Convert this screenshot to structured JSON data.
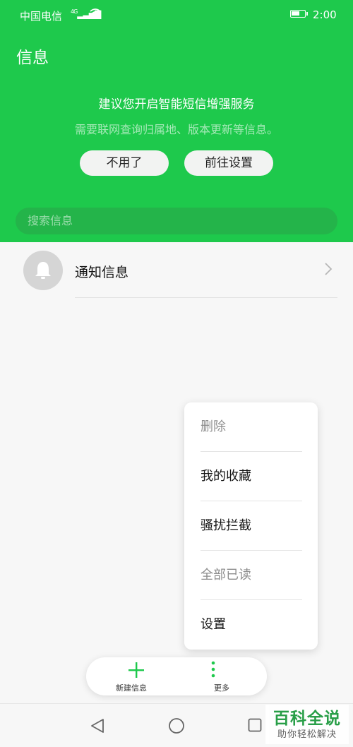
{
  "status_bar": {
    "carrier": "中国电信",
    "network": "4G",
    "time": "2:00"
  },
  "header": {
    "title": "信息"
  },
  "promo": {
    "title": "建议您开启智能短信增强服务",
    "subtitle": "需要联网查询归属地、版本更新等信息。",
    "decline_label": "不用了",
    "settings_label": "前往设置"
  },
  "search": {
    "placeholder": "搜索信息"
  },
  "conversations": [
    {
      "title": "通知信息",
      "icon": "bell-icon"
    }
  ],
  "menu": {
    "items": [
      {
        "label": "删除",
        "enabled": false
      },
      {
        "label": "我的收藏",
        "enabled": true
      },
      {
        "label": "骚扰拦截",
        "enabled": true
      },
      {
        "label": "全部已读",
        "enabled": false
      },
      {
        "label": "设置",
        "enabled": true
      }
    ]
  },
  "bottom_bar": {
    "new_label": "新建信息",
    "more_label": "更多"
  },
  "watermark": {
    "main": "百科全说",
    "sub": "助你轻松解决"
  },
  "colors": {
    "accent": "#1ec94c",
    "search_bg": "#24b44a"
  }
}
